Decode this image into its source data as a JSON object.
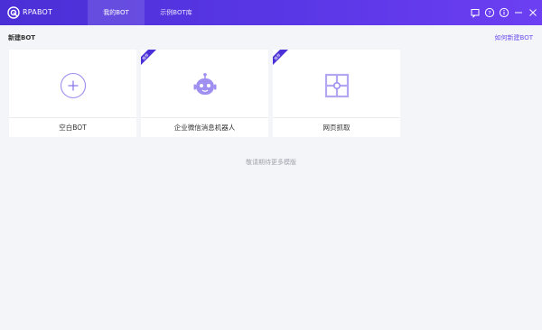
{
  "app": {
    "name": "RPABOT"
  },
  "tabs": [
    {
      "label": "我的BOT",
      "active": true
    },
    {
      "label": "示例BOT库",
      "active": false
    }
  ],
  "window_controls": [
    "comment-icon",
    "help-icon",
    "info-icon",
    "minimize-icon",
    "close-icon"
  ],
  "section": {
    "title": "新建BOT",
    "help_link": "如何新建BOT"
  },
  "cards": [
    {
      "label": "空白BOT",
      "icon": "plus-circle-icon"
    },
    {
      "label": "企业微信消息机器人",
      "icon": "robot-icon",
      "badge": "推荐"
    },
    {
      "label": "网页抓取",
      "icon": "web-scrape-icon",
      "badge": "推荐"
    }
  ],
  "footer_note": "敬请期待更多模版",
  "colors": {
    "accent": "#5a37e6",
    "icon": "#9f8ff0",
    "background": "#f4f5f8"
  }
}
